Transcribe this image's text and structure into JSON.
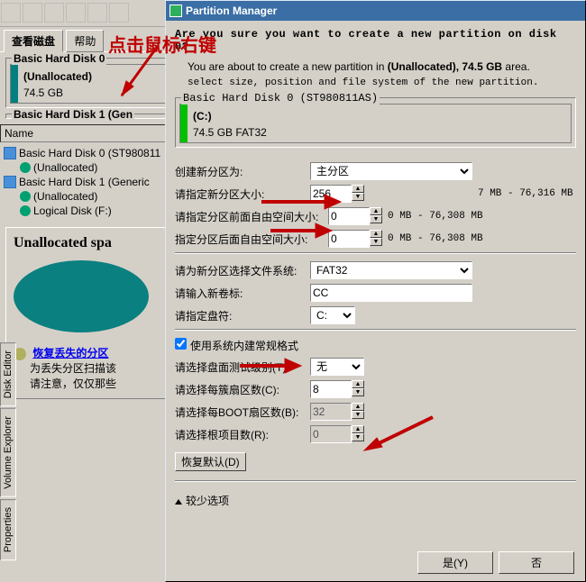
{
  "bg": {
    "tab_view_disks": "查看磁盘",
    "tab_help": "帮助",
    "disk0_group": "Basic Hard Disk 0",
    "disk0_part_name": "(Unallocated)",
    "disk0_part_size": "74.5 GB",
    "disk1_group_cut": "Basic Hard Disk 1 (Gen",
    "tree_header": "Name",
    "tree": {
      "d0": "Basic Hard Disk 0 (ST980811",
      "d0_un": "(Unallocated)",
      "d1": "Basic Hard Disk 1 (Generic",
      "d1_un": "(Unallocated)",
      "d1_log": "Logical Disk (F:)"
    },
    "panel_title": "Unallocated spa",
    "recover_link": "恢复丢失的分区",
    "recover_desc1": "为丢失分区扫描该",
    "recover_desc2": "请注意，仅仅那些",
    "side_tabs": [
      "Disk Editor",
      "Volume Explorer",
      "Properties"
    ]
  },
  "dlg": {
    "title": "Partition Manager",
    "question": "Are you sure you want to create a new partition on disk 0?",
    "info1_a": "You are about to create a new partition in ",
    "info1_b": "(Unallocated), 74.5 GB",
    "info1_c": " area.",
    "info2": "select size, position and file system of the new partition.",
    "disk_legend": "Basic Hard Disk 0 (ST980811AS)",
    "disk_part_name": "(C:)",
    "disk_part_size": "74.5 GB FAT32",
    "field_create_as": "创建新分区为:",
    "val_create_as": "主分区",
    "field_size": "请指定新分区大小:",
    "val_size": "256",
    "tail_size": "7 MB - 76,316 MB",
    "field_free_before": "请指定分区前面自由空间大小:",
    "val_free_before": "0",
    "tail_free_before": "0 MB - 76,308 MB",
    "field_free_after": "指定分区后面自由空间大小:",
    "val_free_after": "0",
    "tail_free_after": "0 MB - 76,308 MB",
    "field_filesystem": "请为新分区选择文件系统:",
    "val_filesystem": "FAT32",
    "field_label": "请输入新卷标:",
    "val_label": "CC",
    "field_drive": "请指定盘符:",
    "val_drive": "C:",
    "chk_defaults": "使用系统内建常规格式",
    "field_surface_test": "请选择盘面测试级别(T):",
    "val_surface_test": "无",
    "field_sectors_per_cluster": "请选择每簇扇区数(C):",
    "val_sectors_per_cluster": "8",
    "field_sectors_per_boot": "请选择每BOOT扇区数(B):",
    "val_sectors_per_boot": "32",
    "field_root_entries": "请选择根项目数(R):",
    "val_root_entries": "0",
    "btn_restore_defaults": "恢复默认(D)",
    "less_options": "较少选项",
    "btn_yes": "是(Y)",
    "btn_no": "否"
  },
  "anno_text": "点击鼠标右键"
}
